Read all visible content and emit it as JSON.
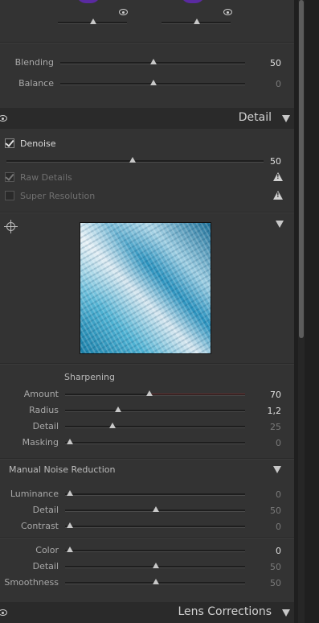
{
  "top": {
    "left_eye": "eye-icon",
    "right_eye": "eye-icon"
  },
  "blend": {
    "blending": {
      "label": "Blending",
      "value": "50"
    },
    "balance": {
      "label": "Balance",
      "value": "0"
    }
  },
  "detail": {
    "title": "Detail",
    "denoise": {
      "label": "Denoise",
      "value": "50",
      "checked": true
    },
    "raw_details": {
      "label": "Raw Details",
      "checked": true
    },
    "super_resolution": {
      "label": "Super Resolution",
      "checked": false
    }
  },
  "sharpening": {
    "title": "Sharpening",
    "amount": {
      "label": "Amount",
      "value": "70"
    },
    "radius": {
      "label": "Radius",
      "value": "1,2"
    },
    "detail": {
      "label": "Detail",
      "value": "25"
    },
    "masking": {
      "label": "Masking",
      "value": "0"
    }
  },
  "noise": {
    "title": "Manual Noise Reduction",
    "luminance": {
      "label": "Luminance",
      "value": "0"
    },
    "lum_detail": {
      "label": "Detail",
      "value": "50"
    },
    "contrast": {
      "label": "Contrast",
      "value": "0"
    },
    "color": {
      "label": "Color",
      "value": "0"
    },
    "color_detail": {
      "label": "Detail",
      "value": "50"
    },
    "smoothness": {
      "label": "Smoothness",
      "value": "50"
    }
  },
  "lens": {
    "title": "Lens Corrections"
  }
}
